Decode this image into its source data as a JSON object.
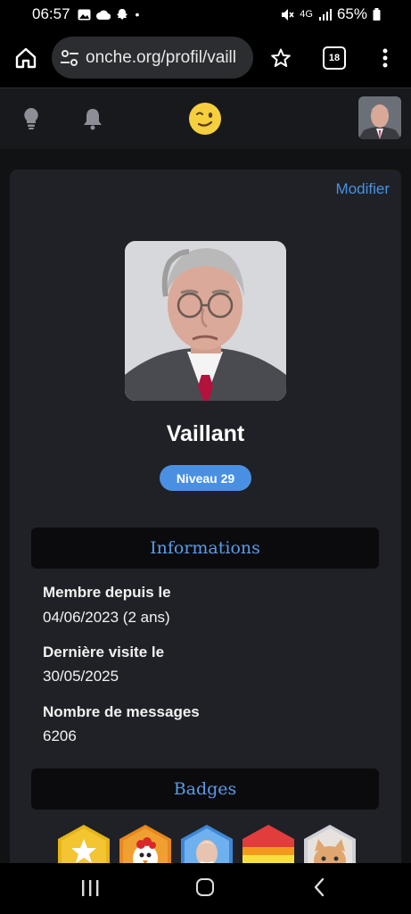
{
  "status_bar": {
    "time": "06:57",
    "network": "4G",
    "battery": "65%"
  },
  "browser": {
    "url": "onche.org/profil/vaill",
    "tab_count": "18"
  },
  "header": {
    "logo_icon": "winking-face-icon"
  },
  "profile": {
    "edit_label": "Modifier",
    "username": "Vaillant",
    "level": "Niveau 29"
  },
  "informations": {
    "title": "Informations",
    "member_since_label": "Membre depuis le",
    "member_since_value": "04/06/2023 (2 ans)",
    "last_visit_label": "Dernière visite le",
    "last_visit_value": "30/05/2025",
    "messages_label": "Nombre de messages",
    "messages_value": "6206"
  },
  "badges": {
    "title": "Badges",
    "items": [
      "star-badge",
      "chicken-badge",
      "old-man-badge",
      "rainbow-badge",
      "cat-badge"
    ]
  },
  "colors": {
    "accent": "#4a90e2",
    "card": "#1f2126",
    "header": "#18191c"
  }
}
